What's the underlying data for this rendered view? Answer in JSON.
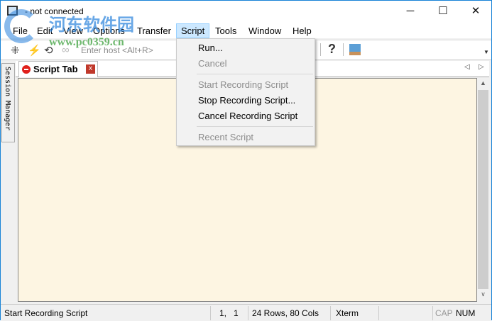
{
  "window": {
    "title": "- not connected",
    "controls": {
      "minimize": "─",
      "maximize": "☐",
      "close": "✕"
    }
  },
  "menu": [
    "File",
    "Edit",
    "View",
    "Options",
    "Transfer",
    "Script",
    "Tools",
    "Window",
    "Help"
  ],
  "toolbar": {
    "host_placeholder": "Enter host <Alt+R>",
    "help": "?"
  },
  "tab": {
    "label": "Script Tab",
    "close": "x",
    "prev": "◁",
    "next": "▷"
  },
  "session_manager": "Session Manager",
  "script_menu": {
    "items": [
      {
        "label": "Run...",
        "enabled": true
      },
      {
        "label": "Cancel",
        "enabled": false
      },
      {
        "label": "Start Recording Script",
        "enabled": false
      },
      {
        "label": "Stop Recording Script...",
        "enabled": true
      },
      {
        "label": "Cancel Recording Script",
        "enabled": true
      },
      {
        "label": "Recent Script",
        "enabled": false
      }
    ]
  },
  "status": {
    "message": "Start Recording Script",
    "cursor": "1,   1",
    "size": "24 Rows, 80 Cols",
    "emulation": "Xterm",
    "cap": "CAP",
    "num": "NUM"
  },
  "watermark": {
    "name": "河东软件园",
    "url": "www.pc0359.cn"
  }
}
